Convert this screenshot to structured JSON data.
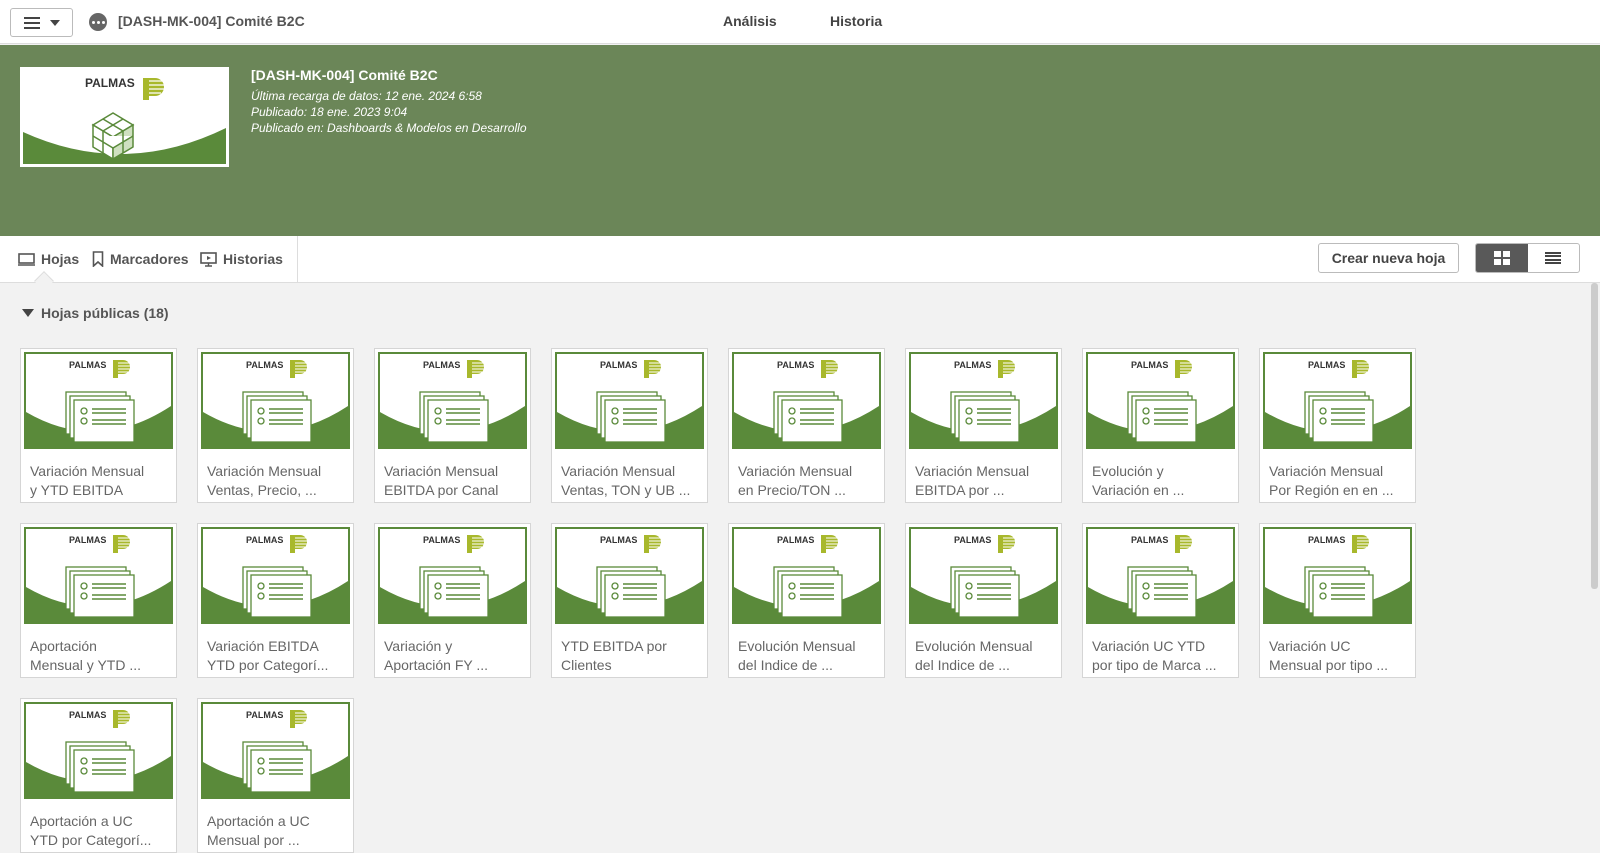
{
  "header": {
    "app_title": "[DASH-MK-004] Comité B2C",
    "tabs": [
      {
        "label": "Análisis"
      },
      {
        "label": "Historia"
      }
    ]
  },
  "hero": {
    "logo_text": "PALMAS",
    "title": "[DASH-MK-004] Comité B2C",
    "last_reload": "Última recarga de datos: 12 ene. 2024 6:58",
    "published": "Publicado: 18 ene. 2023 9:04",
    "published_in": "Publicado en: Dashboards & Modelos en Desarrollo"
  },
  "subnav": {
    "tabs": [
      {
        "label": "Hojas",
        "icon": "sheet-icon"
      },
      {
        "label": "Marcadores",
        "icon": "bookmark-icon"
      },
      {
        "label": "Historias",
        "icon": "story-icon"
      }
    ],
    "create_label": "Crear nueva hoja"
  },
  "section": {
    "title": "Hojas públicas (18)"
  },
  "colors": {
    "hero_bg": "#6b8658",
    "brand_green": "#5a8a3a",
    "logo_p_yellow": "#a8b82c"
  },
  "sheets": [
    {
      "line1": "Variación Mensual",
      "line2": "y YTD EBITDA"
    },
    {
      "line1": "Variación Mensual",
      "line2": "Ventas, Precio,      ..."
    },
    {
      "line1": "Variación Mensual",
      "line2": "EBITDA por Canal"
    },
    {
      "line1": "Variación Mensual",
      "line2": "Ventas, TON y UB ..."
    },
    {
      "line1": "Variación Mensual",
      "line2": "en Precio/TON       ..."
    },
    {
      "line1": "Variación Mensual",
      "line2": "EBITDA por          ..."
    },
    {
      "line1": "Evolución y",
      "line2": "Variación en         ..."
    },
    {
      "line1": "Variación Mensual",
      "line2": "Por Región en en  ..."
    },
    {
      "line1": "Aportación",
      "line2": "Mensual y YTD       ..."
    },
    {
      "line1": "Variación EBITDA",
      "line2": "YTD por Categorí..."
    },
    {
      "line1": "Variación y",
      "line2": "Aportación FY       ..."
    },
    {
      "line1": "YTD EBITDA por",
      "line2": "Clientes"
    },
    {
      "line1": "Evolución Mensual",
      "line2": "del Indice de        ..."
    },
    {
      "line1": "Evolución Mensual",
      "line2": "del Indice de        ..."
    },
    {
      "line1": "Variación UC YTD",
      "line2": "por tipo de Marca ..."
    },
    {
      "line1": "Variación UC",
      "line2": "Mensual por tipo   ..."
    },
    {
      "line1": "Aportación a UC",
      "line2": "YTD por Categorí..."
    },
    {
      "line1": "Aportación a UC",
      "line2": "Mensual por          ..."
    }
  ]
}
